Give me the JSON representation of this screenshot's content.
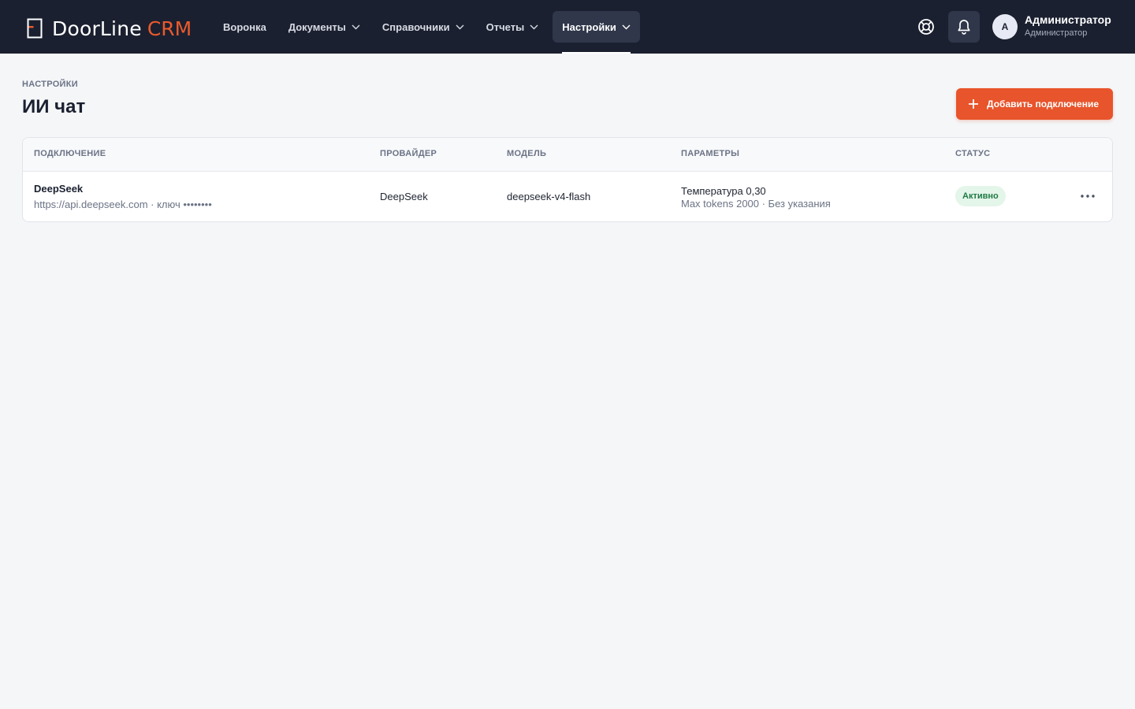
{
  "app": {
    "logo_text": "DoorLine",
    "logo_accent": "CRM",
    "brand_color": "#ea5a2c"
  },
  "nav": {
    "items": [
      {
        "label": "Воронка",
        "has_dropdown": false
      },
      {
        "label": "Документы",
        "has_dropdown": true
      },
      {
        "label": "Справочники",
        "has_dropdown": true
      },
      {
        "label": "Отчеты",
        "has_dropdown": true
      },
      {
        "label": "Настройки",
        "has_dropdown": true,
        "active": true
      }
    ]
  },
  "header_icons": {
    "help": "lifebuoy-icon",
    "notifications": "bell-icon"
  },
  "user": {
    "avatar_initial": "А",
    "name": "Администратор",
    "role": "Администратор"
  },
  "page": {
    "breadcrumb": "НАСТРОЙКИ",
    "title": "ИИ чат",
    "add_button_label": "Добавить подключение"
  },
  "table": {
    "columns": [
      "ПОДКЛЮЧЕНИЕ",
      "ПРОВАЙДЕР",
      "МОДЕЛЬ",
      "ПАРАМЕТРЫ",
      "СТАТУС"
    ],
    "rows": [
      {
        "name": "DeepSeek",
        "details": "https://api.deepseek.com · ключ ••••••••",
        "provider": "DeepSeek",
        "model": "deepseek-v4-flash",
        "param_line1": "Температура 0,30",
        "param_line2": "Max tokens 2000 · Без указания",
        "status": "Активно",
        "status_color": "#1f7a45"
      }
    ]
  }
}
